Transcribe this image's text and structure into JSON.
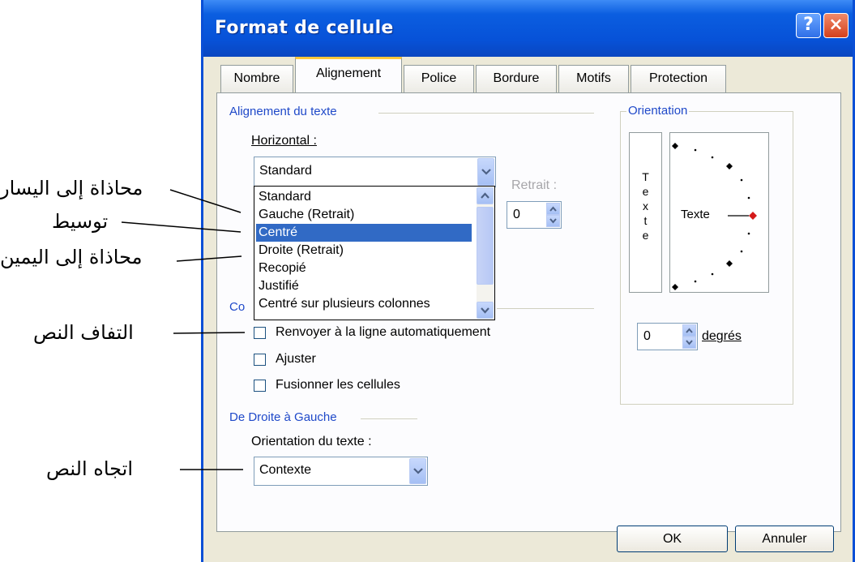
{
  "window": {
    "title": "Format de cellule",
    "help_glyph": "?",
    "close_glyph": "×"
  },
  "tabs": [
    {
      "label": "Nombre"
    },
    {
      "label": "Alignement",
      "active": true
    },
    {
      "label": "Police"
    },
    {
      "label": "Bordure"
    },
    {
      "label": "Motifs"
    },
    {
      "label": "Protection"
    }
  ],
  "text_alignment": {
    "group_label": "Alignement du texte",
    "horizontal_label": "Horizontal :",
    "horizontal_value": "Standard",
    "indent_label": "Retrait :",
    "indent_value": "0",
    "dropdown_options": [
      "Standard",
      "Gauche (Retrait)",
      "Centré",
      "Droite (Retrait)",
      "Recopié",
      "Justifié",
      "Centré sur plusieurs colonnes"
    ],
    "selected_option": "Centré"
  },
  "text_control": {
    "group_label_partial": "Co",
    "wrap_text": "Renvoyer à la ligne automatiquement",
    "shrink_to_fit": "Ajuster",
    "merge_cells": "Fusionner les cellules"
  },
  "rtl": {
    "group_label": "De Droite à Gauche",
    "text_direction_label": "Orientation du texte :",
    "text_direction_value": "Contexte"
  },
  "orientation": {
    "group_label": "Orientation",
    "vertical_text": [
      "T",
      "e",
      "x",
      "t",
      "e"
    ],
    "dial_label": "Texte",
    "degrees_value": "0",
    "degrees_label": "degrés"
  },
  "buttons": {
    "ok": "OK",
    "cancel": "Annuler"
  },
  "callouts": {
    "align_left": "محاذاة إلى اليسار",
    "center": "توسيط",
    "align_right": "محاذاة إلى اليمين",
    "wrap_text": "التفاف النص",
    "text_direction": "اتجاه النص"
  },
  "colors": {
    "titlebar": "#0752d8",
    "dialog_bg": "#ece9d8",
    "group_label": "#1f49c9",
    "selection": "#316ac5",
    "active_tab_accent": "#ffc83c"
  }
}
